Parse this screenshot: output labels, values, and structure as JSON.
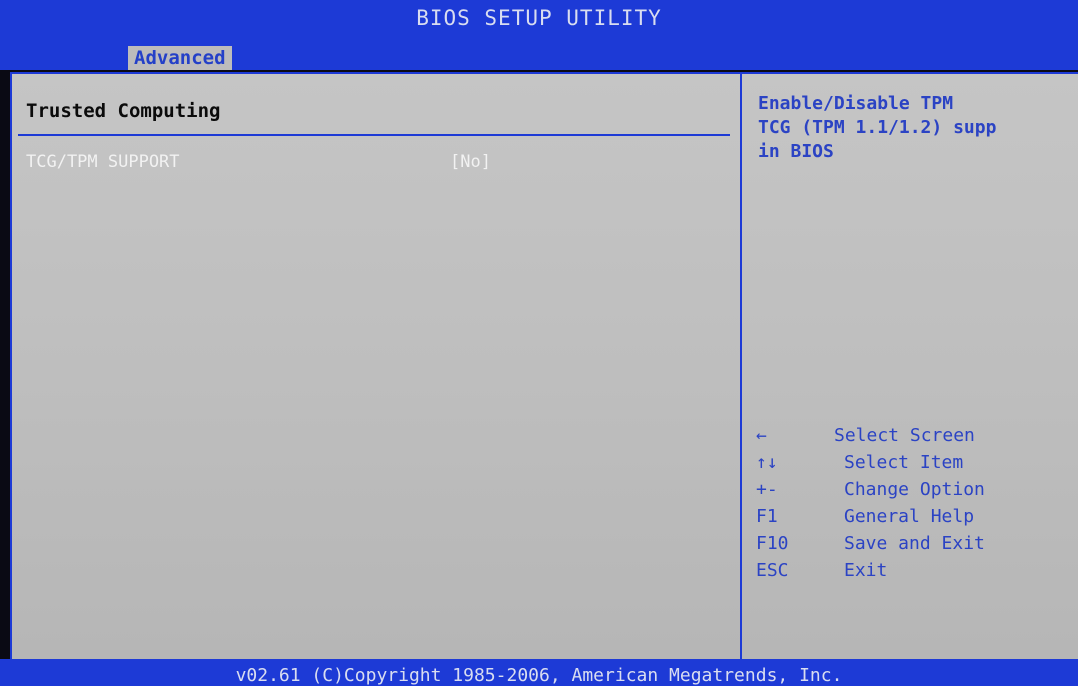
{
  "header": {
    "title": "BIOS SETUP UTILITY",
    "active_tab": "Advanced"
  },
  "main": {
    "section_title": "Trusted Computing",
    "items": [
      {
        "label": "TCG/TPM SUPPORT",
        "value": "[No]"
      }
    ]
  },
  "help": {
    "lines": [
      "Enable/Disable TPM",
      "TCG (TPM 1.1/1.2) supp",
      "in BIOS"
    ]
  },
  "keys": [
    {
      "key": "←",
      "desc": "Select Screen"
    },
    {
      "key": "↑↓",
      "desc": "Select Item"
    },
    {
      "key": "+-",
      "desc": "Change Option"
    },
    {
      "key": "F1",
      "desc": "General Help"
    },
    {
      "key": "F10",
      "desc": "Save and Exit"
    },
    {
      "key": "ESC",
      "desc": "Exit"
    }
  ],
  "footer": {
    "copyright": "v02.61 (C)Copyright 1985-2006, American Megatrends, Inc."
  },
  "colors": {
    "accent": "#1d3ad6",
    "panel": "#bfbfbf",
    "help_text": "#2b43c4"
  }
}
